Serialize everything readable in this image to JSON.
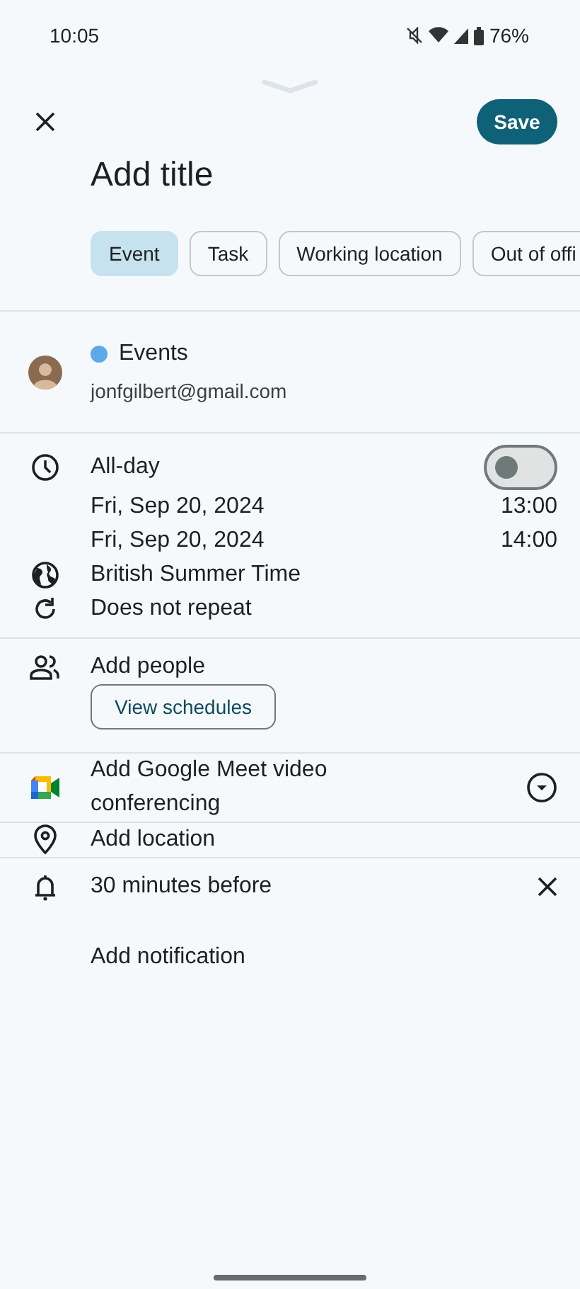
{
  "status_bar": {
    "time": "10:05",
    "battery": "76%"
  },
  "header": {
    "save": "Save",
    "title_placeholder": "Add title"
  },
  "event_types": [
    {
      "label": "Event",
      "selected": true
    },
    {
      "label": "Task",
      "selected": false
    },
    {
      "label": "Working location",
      "selected": false
    },
    {
      "label": "Out of offi",
      "selected": false
    }
  ],
  "calendar": {
    "name": "Events",
    "color": "#5ea8ec",
    "account": "jonfgilbert@gmail.com"
  },
  "time": {
    "all_day_label": "All-day",
    "all_day": false,
    "start": {
      "date": "Fri, Sep 20, 2024",
      "time": "13:00"
    },
    "end": {
      "date": "Fri, Sep 20, 2024",
      "time": "14:00"
    },
    "timezone": "British Summer Time",
    "repeat": "Does not repeat"
  },
  "people": {
    "label": "Add people",
    "button": "View schedules"
  },
  "conferencing": {
    "label": "Add Google Meet video conferencing"
  },
  "location": {
    "label": "Add location"
  },
  "notifications": [
    {
      "label": "30 minutes before"
    }
  ],
  "add_notification": "Add notification"
}
